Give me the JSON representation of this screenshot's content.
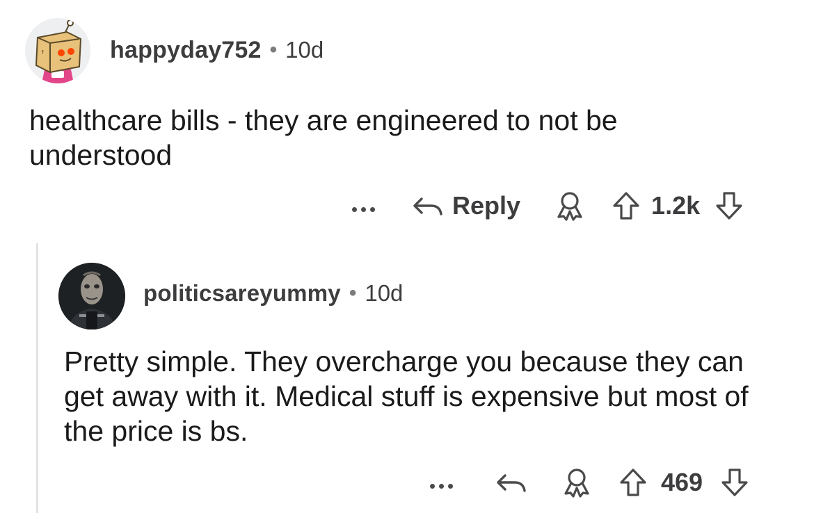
{
  "comments": [
    {
      "username": "happyday752",
      "separator": "•",
      "age": "10d",
      "body": "healthcare bills - they are engineered to not be understood",
      "reply_label": "Reply",
      "score": "1.2k",
      "icons": [
        "more-options-icon",
        "reply-arrow-icon",
        "award-icon",
        "upvote-icon",
        "downvote-icon"
      ],
      "avatar": {
        "description_icon": "box-head-avatar-icon"
      }
    },
    {
      "username": "politicsareyummy",
      "separator": "•",
      "age": "10d",
      "body": "Pretty simple. They overcharge you because they can get away with it. Medical stuff is expensive but most of the price is bs.",
      "score": "469",
      "icons": [
        "more-options-icon",
        "reply-arrow-icon",
        "award-icon",
        "upvote-icon",
        "downvote-icon"
      ],
      "avatar": {
        "description_icon": "masked-figure-avatar-icon"
      }
    }
  ],
  "colors": {
    "text": "#1a1a1b",
    "meta": "#3d3d3f",
    "thread_line": "#e2e2e2",
    "avatar_accent": "#ff4500"
  }
}
